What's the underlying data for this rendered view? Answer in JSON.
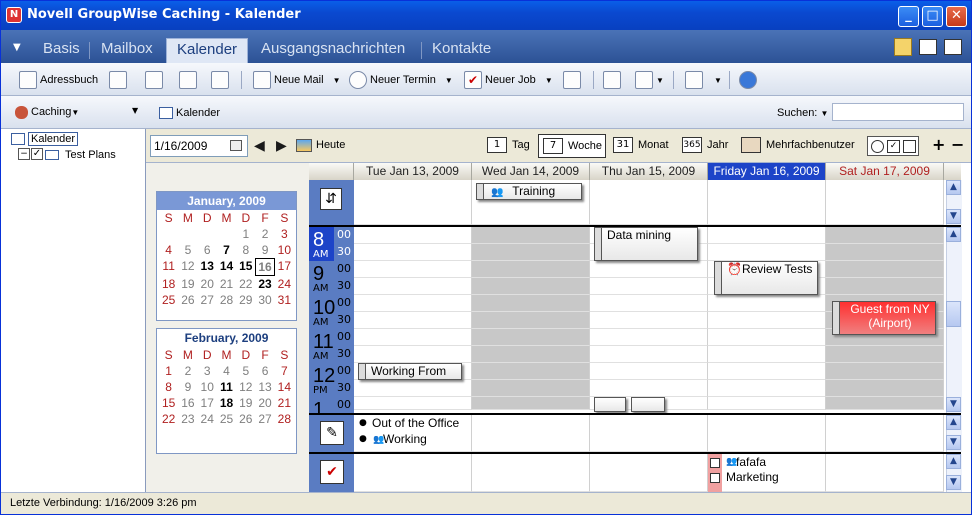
{
  "window": {
    "title": "Novell GroupWise Caching - Kalender"
  },
  "nav": {
    "tabs": [
      "Basis",
      "Mailbox",
      "Kalender",
      "Ausgangsnachrichten",
      "Kontakte"
    ],
    "selected": "Kalender"
  },
  "toolbar": {
    "address_book": "Adressbuch",
    "new_mail": "Neue Mail",
    "new_appointment": "Neuer Termin",
    "new_job": "Neuer Job"
  },
  "left": {
    "header": "Caching",
    "tree": {
      "root": "Kalender",
      "child": "Test Plans"
    }
  },
  "calendar_header": {
    "title": "Kalender",
    "search_label": "Suchen:",
    "search_value": ""
  },
  "datebar": {
    "date": "1/16/2009",
    "today": "Heute",
    "views": [
      "Tag",
      "Woche",
      "Monat",
      "Jahr",
      "Mehrfachbenutzer"
    ],
    "selected_view": "Woche",
    "view_icons": [
      "1",
      "7",
      "31",
      "365"
    ]
  },
  "mini_cal": [
    {
      "title": "January, 2009",
      "days_hdr": [
        "S",
        "M",
        "D",
        "M",
        "D",
        "F",
        "S"
      ],
      "rows": [
        [
          "",
          "",
          "",
          "",
          "1",
          "2",
          "3"
        ],
        [
          "4",
          "5",
          "6",
          "7",
          "8",
          "9",
          "10"
        ],
        [
          "11",
          "12",
          "13",
          "14",
          "15",
          "16",
          "17"
        ],
        [
          "18",
          "19",
          "20",
          "21",
          "22",
          "23",
          "24"
        ],
        [
          "25",
          "26",
          "27",
          "28",
          "29",
          "30",
          "31"
        ]
      ]
    },
    {
      "title": "February, 2009",
      "days_hdr": [
        "S",
        "M",
        "D",
        "M",
        "D",
        "F",
        "S"
      ],
      "rows": [
        [
          "1",
          "2",
          "3",
          "4",
          "5",
          "6",
          "7"
        ],
        [
          "8",
          "9",
          "10",
          "11",
          "12",
          "13",
          "14"
        ],
        [
          "15",
          "16",
          "17",
          "18",
          "19",
          "20",
          "21"
        ],
        [
          "22",
          "23",
          "24",
          "25",
          "26",
          "27",
          "28"
        ]
      ]
    }
  ],
  "week": {
    "days": [
      "Tue Jan 13, 2009",
      "Wed Jan 14, 2009",
      "Thu Jan 15, 2009",
      "Friday Jan 16, 2009",
      "Sat Jan 17, 2009"
    ],
    "hours": [
      {
        "h": "8",
        "ap": "AM"
      },
      {
        "h": "9",
        "ap": "AM"
      },
      {
        "h": "10",
        "ap": "AM"
      },
      {
        "h": "11",
        "ap": "AM"
      },
      {
        "h": "12",
        "ap": "PM"
      },
      {
        "h": "1",
        "ap": ""
      }
    ],
    "minutes": [
      "00",
      "30"
    ],
    "allday": [
      {
        "day": 1,
        "text": "Training"
      }
    ],
    "appointments": [
      {
        "text": "Data mining",
        "day": 2
      },
      {
        "text": "Review Tests",
        "day": 3
      },
      {
        "text": "Guest from NY (Airport)",
        "day": 4
      },
      {
        "text": "Working From",
        "day": 0
      }
    ],
    "notes": [
      "Out of the Office",
      "Working"
    ],
    "tasks": [
      "fafafa",
      "Marketing"
    ]
  },
  "status": {
    "text": "Letzte Verbindung: 1/16/2009 3:26 pm"
  }
}
